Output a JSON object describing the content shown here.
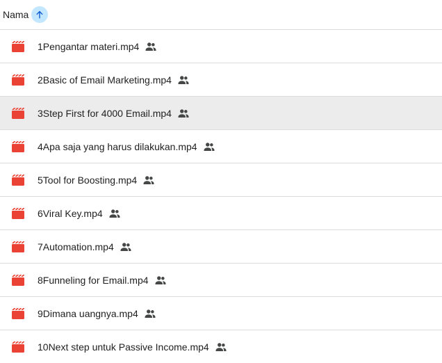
{
  "header": {
    "column_label": "Nama",
    "sort_icon": "arrow-up-icon",
    "sort_button_color": "#c2e7ff"
  },
  "colors": {
    "video_icon": "#ea4335",
    "shared_icon": "#444746",
    "row_hover": "#ececec",
    "divider": "#dadce0"
  },
  "files": [
    {
      "name": "1Pengantar materi.mp4",
      "icon": "video-file-icon",
      "shared": true
    },
    {
      "name": "2Basic of Email Marketing.mp4",
      "icon": "video-file-icon",
      "shared": true
    },
    {
      "name": "3Step First for 4000 Email.mp4",
      "icon": "video-file-icon",
      "shared": true,
      "hovered": true
    },
    {
      "name": "4Apa saja yang harus dilakukan.mp4",
      "icon": "video-file-icon",
      "shared": true
    },
    {
      "name": "5Tool for Boosting.mp4",
      "icon": "video-file-icon",
      "shared": true
    },
    {
      "name": "6Viral Key.mp4",
      "icon": "video-file-icon",
      "shared": true
    },
    {
      "name": "7Automation.mp4",
      "icon": "video-file-icon",
      "shared": true
    },
    {
      "name": "8Funneling for Email.mp4",
      "icon": "video-file-icon",
      "shared": true
    },
    {
      "name": "9Dimana uangnya.mp4",
      "icon": "video-file-icon",
      "shared": true
    },
    {
      "name": "10Next step untuk Passive Income.mp4",
      "icon": "video-file-icon",
      "shared": true
    }
  ]
}
